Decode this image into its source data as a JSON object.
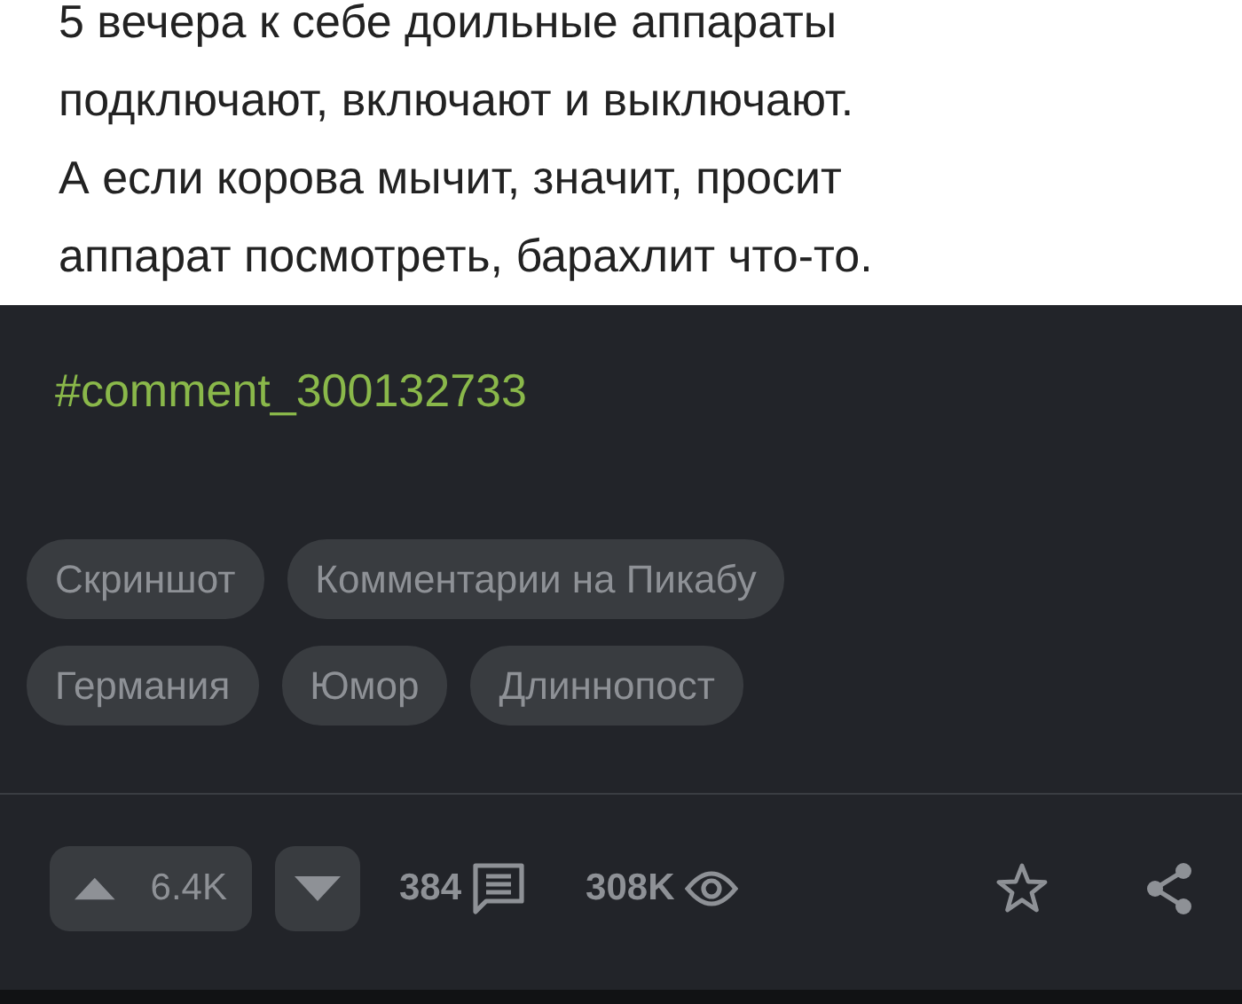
{
  "post_text": "5 вечера к себе доильные аппараты\nподключают, включают и выключают.\nА если корова мычит, значит, просит\nаппарат посмотреть, барахлит что-то.",
  "hashtag": "#comment_300132733",
  "tags": [
    [
      "Скриншот",
      "Комментарии на Пикабу"
    ],
    [
      "Германия",
      "Юмор",
      "Длиннопост"
    ]
  ],
  "actions": {
    "upvotes": "6.4K",
    "comments": "384",
    "views": "308K"
  }
}
